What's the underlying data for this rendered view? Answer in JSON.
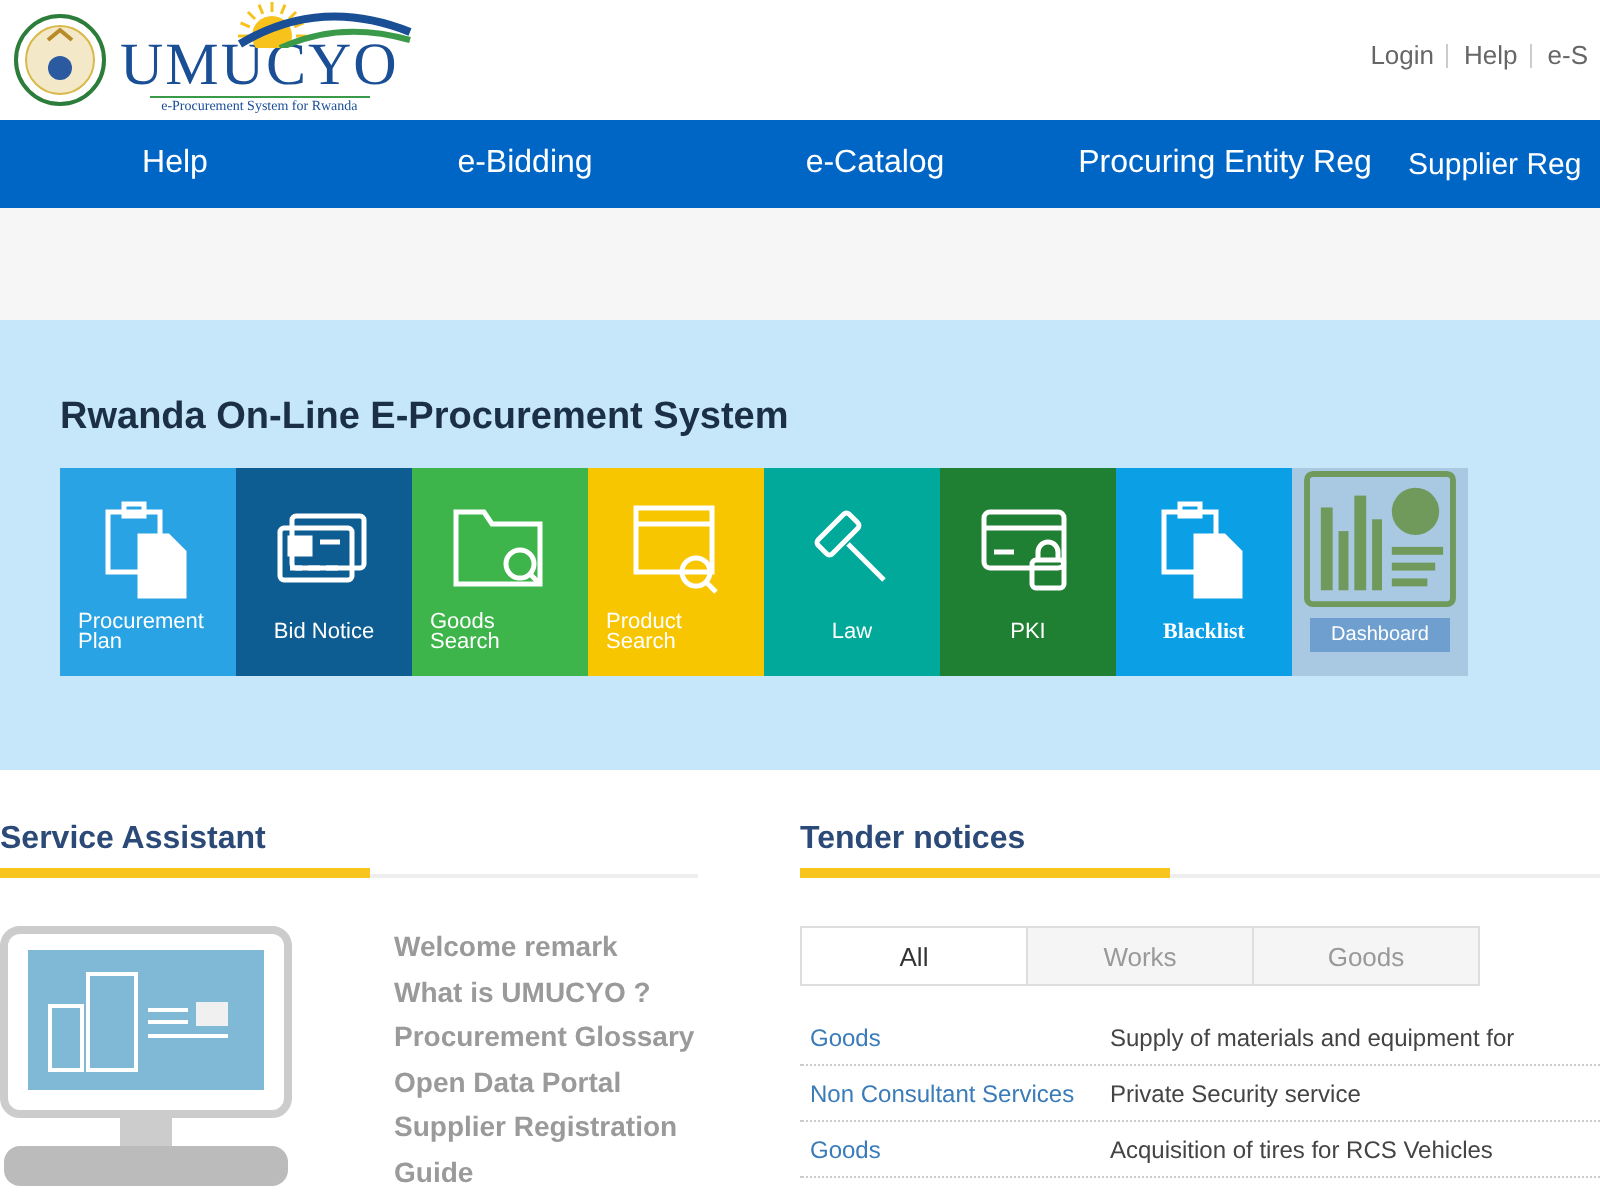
{
  "header": {
    "logo_title": "UMUCYO",
    "logo_subtitle": "e-Procurement System for Rwanda",
    "links": [
      "Login",
      "Help",
      "e-S"
    ]
  },
  "nav": [
    "Help",
    "e-Bidding",
    "e-Catalog",
    "Procuring Entity Reg",
    "Supplier Reg"
  ],
  "hero": {
    "title": "Rwanda On-Line E-Procurement System",
    "tiles": [
      {
        "label": "Procurement Plan",
        "kind": "clipboard",
        "color": "#29a3e4"
      },
      {
        "label": "Bid Notice",
        "kind": "cards",
        "color": "#0e5d92"
      },
      {
        "label": "Goods Search",
        "kind": "folder",
        "color": "#3db54a"
      },
      {
        "label": "Product Search",
        "kind": "browser",
        "color": "#f8c600"
      },
      {
        "label": "Law",
        "kind": "gavel",
        "color": "#00a99a"
      },
      {
        "label": "PKI",
        "kind": "lockcard",
        "color": "#1f7f33"
      },
      {
        "label": "Blacklist",
        "kind": "clipboard",
        "color": "#0b9fe6"
      },
      {
        "label": "Dashboard",
        "kind": "dashboard",
        "color": "#a9c8e2"
      }
    ]
  },
  "service_assistant": {
    "title": "Service Assistant",
    "links": [
      "Welcome remark",
      "What is UMUCYO ?",
      "Procurement Glossary",
      "Open Data Portal",
      "Supplier Registration",
      "Guide"
    ]
  },
  "tender_notices": {
    "title": "Tender notices",
    "tabs": [
      {
        "label": "All",
        "selected": true
      },
      {
        "label": "Works",
        "selected": false
      },
      {
        "label": "Goods",
        "selected": false
      }
    ],
    "rows": [
      {
        "category": "Goods",
        "title": "Supply of materials and equipment for"
      },
      {
        "category": "Non Consultant Services",
        "title": "Private Security service"
      },
      {
        "category": "Goods",
        "title": "Acquisition of tires for RCS Vehicles"
      }
    ]
  }
}
